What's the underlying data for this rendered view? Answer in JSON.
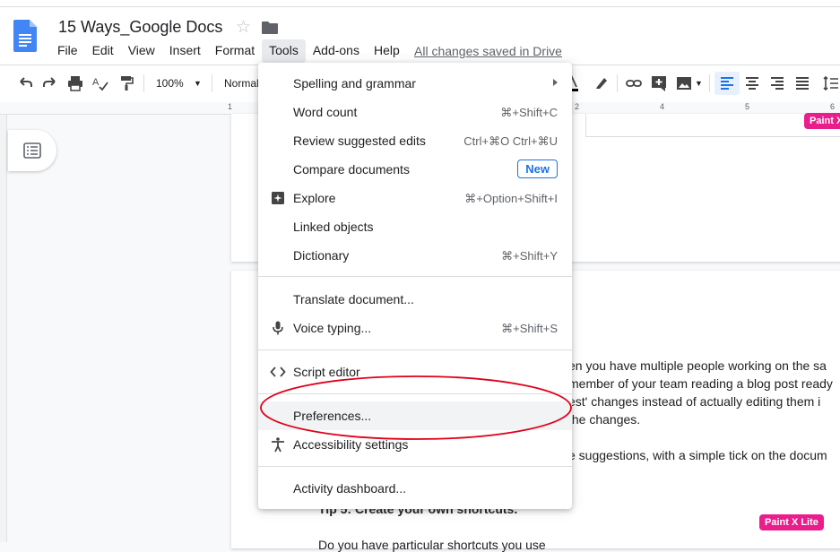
{
  "doc": {
    "title": "15 Ways_Google Docs",
    "saved_status": "All changes saved in Drive"
  },
  "menu": [
    "File",
    "Edit",
    "View",
    "Insert",
    "Format",
    "Tools",
    "Add-ons",
    "Help"
  ],
  "toolbar": {
    "zoom": "100%",
    "style": "Normal"
  },
  "ruler": [
    "1",
    "1",
    "2",
    "3",
    "4",
    "5",
    "6"
  ],
  "tools_menu": [
    {
      "label": "Spelling and grammar",
      "shortcut": "",
      "submenu": true
    },
    {
      "label": "Word count",
      "shortcut": "⌘+Shift+C"
    },
    {
      "label": "Review suggested edits",
      "shortcut": "Ctrl+⌘O Ctrl+⌘U"
    },
    {
      "label": "Compare documents",
      "badge": "New"
    },
    {
      "label": "Explore",
      "shortcut": "⌘+Option+Shift+I",
      "icon": "explore-icon"
    },
    {
      "label": "Linked objects",
      "shortcut": ""
    },
    {
      "label": "Dictionary",
      "shortcut": "⌘+Shift+Y"
    },
    {
      "label": "Translate document...",
      "shortcut": ""
    },
    {
      "label": "Voice typing...",
      "shortcut": "⌘+Shift+S",
      "icon": "microphone-icon"
    },
    {
      "label": "Script editor",
      "shortcut": "",
      "icon": "code-icon"
    },
    {
      "label": "Preferences...",
      "shortcut": ""
    },
    {
      "label": "Accessibility settings",
      "shortcut": "",
      "icon": "accessibility-icon"
    },
    {
      "label": "Activity dashboard...",
      "shortcut": ""
    }
  ],
  "document_text": [
    "en you have multiple people working on the sa",
    "member of your team reading a blog post ready",
    "est' changes instead of actually editing them i",
    "the changes.",
    "e suggestions, with a simple tick on the docum",
    "Tip 5: Create your own shortcuts.",
    "Do you have particular shortcuts you use"
  ],
  "badges": {
    "paint_top": "Paint X",
    "paint_bottom": "Paint X Lite"
  },
  "colors": {
    "accent": "#1a73e8",
    "annotation": "#e0001b",
    "badge": "#e91e8c"
  }
}
